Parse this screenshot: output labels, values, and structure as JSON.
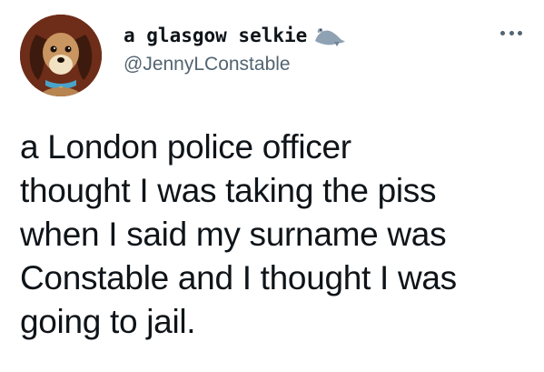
{
  "user": {
    "display_name": "a glasgow selkie",
    "handle": "@JennyLConstable",
    "name_emoji": "seal-icon",
    "avatar": "avatar-cartoon-dog"
  },
  "menu": {
    "icon": "more-horizontal-icon"
  },
  "tweet": {
    "lines": [
      "a London police officer",
      "thought I was taking the piss",
      "when I said my surname was",
      "Constable and I thought I was",
      "going to jail."
    ]
  },
  "colors": {
    "text": "#0f1419",
    "secondary": "#536471"
  }
}
